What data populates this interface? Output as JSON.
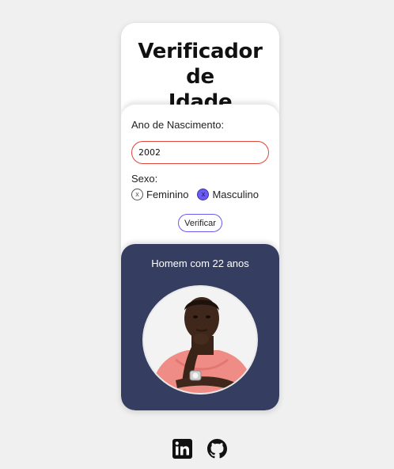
{
  "header": {
    "title_line1": "Verificador de",
    "title_line2": "Idade"
  },
  "form": {
    "year_label": "Ano de Nascimento:",
    "year_value": "2002",
    "sex_label": "Sexo:",
    "options": [
      {
        "label": "Feminino",
        "mark": "x",
        "checked": false
      },
      {
        "label": "Masculino",
        "mark": "x",
        "checked": true
      }
    ],
    "verify_label": "Verificar"
  },
  "result": {
    "text": "Homem com 22 anos",
    "photo_icon": "man-portrait-photo"
  },
  "footer": {
    "icons": [
      "linkedin-icon",
      "github-icon"
    ]
  },
  "colors": {
    "background": "#f0f0f0",
    "result_bg": "#353e60",
    "accent": "#6a5cf0",
    "input_border": "#e0483c"
  }
}
